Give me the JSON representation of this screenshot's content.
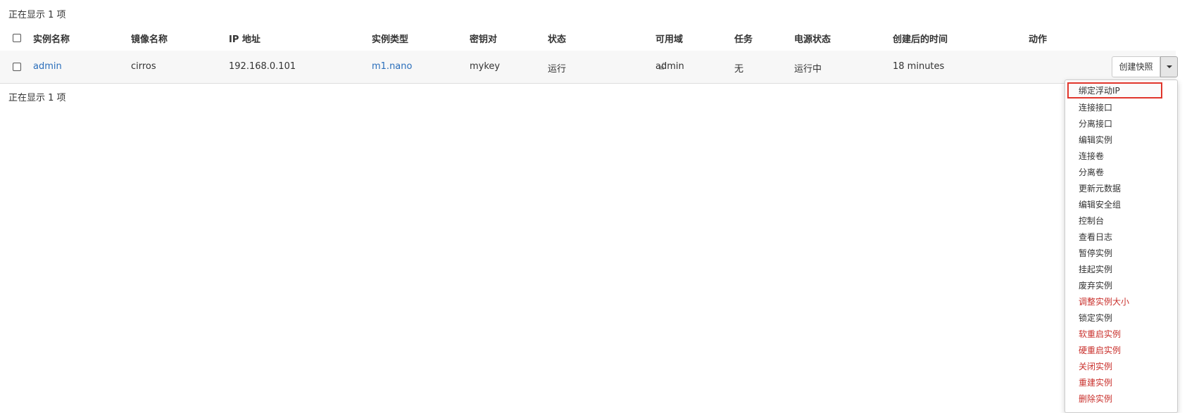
{
  "count_text": "正在显示 1 项",
  "headers": {
    "name": "实例名称",
    "image": "镜像名称",
    "ip": "IP 地址",
    "flavor": "实例类型",
    "keypair": "密钥对",
    "status": "状态",
    "az": "可用域",
    "task": "任务",
    "power": "电源状态",
    "age": "创建后的时间",
    "actions": "动作"
  },
  "row": {
    "name": "admin",
    "image": "cirros",
    "ip": "192.168.0.101",
    "flavor": "m1.nano",
    "keypair": "mykey",
    "status": "运行",
    "az": "admin",
    "task": "无",
    "power": "运行中",
    "age": "18 minutes"
  },
  "action_button": "创建快照",
  "menu": {
    "bind_fip": "绑定浮动IP",
    "attach_iface": "连接接口",
    "detach_iface": "分离接口",
    "edit_instance": "编辑实例",
    "attach_volume": "连接卷",
    "detach_volume": "分离卷",
    "update_metadata": "更新元数据",
    "edit_secgroups": "编辑安全组",
    "console": "控制台",
    "view_log": "查看日志",
    "pause": "暂停实例",
    "suspend": "挂起实例",
    "shelve": "废弃实例",
    "resize": "调整实例大小",
    "lock": "锁定实例",
    "soft_reboot": "软重启实例",
    "hard_reboot": "硬重启实例",
    "shutoff": "关闭实例",
    "rebuild": "重建实例",
    "delete": "删除实例"
  },
  "colors": {
    "link": "#2a6ebb",
    "danger": "#c9302c",
    "highlight_border": "#e0352b"
  }
}
